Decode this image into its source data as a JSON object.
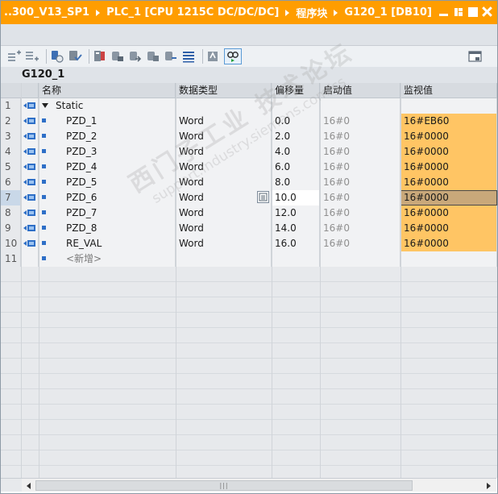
{
  "titlebar": {
    "crumbs": [
      "..300_V13_SP1",
      "PLC_1 [CPU 1215C DC/DC/DC]",
      "程序块",
      "G120_1 [DB10]"
    ]
  },
  "toolbar": {
    "icons": [
      "insert-row-icon",
      "add-row-icon",
      "reset-start-values-icon",
      "load-start-values-icon",
      "snapshot-icon",
      "copy-snapshot-icon",
      "load-snapshot-icon",
      "copy-snapshot-to-start-icon",
      "copy-start-to-snapshot-icon",
      "expand-all-icon",
      "show-settings-icon",
      "monitor-all-icon",
      "layout-icon"
    ]
  },
  "block": {
    "name": "G120_1"
  },
  "table": {
    "headers": [
      "名称",
      "数据类型",
      "偏移量",
      "启动值",
      "监视值"
    ],
    "static_row": {
      "num": "1",
      "name": "Static"
    },
    "rows": [
      {
        "num": "2",
        "name": "PZD_1",
        "type": "Word",
        "offset": "0.0",
        "start": "16#0",
        "monitor": "16#EB60"
      },
      {
        "num": "3",
        "name": "PZD_2",
        "type": "Word",
        "offset": "2.0",
        "start": "16#0",
        "monitor": "16#0000"
      },
      {
        "num": "4",
        "name": "PZD_3",
        "type": "Word",
        "offset": "4.0",
        "start": "16#0",
        "monitor": "16#0000"
      },
      {
        "num": "5",
        "name": "PZD_4",
        "type": "Word",
        "offset": "6.0",
        "start": "16#0",
        "monitor": "16#0000"
      },
      {
        "num": "6",
        "name": "PZD_5",
        "type": "Word",
        "offset": "8.0",
        "start": "16#0",
        "monitor": "16#0000"
      },
      {
        "num": "7",
        "name": "PZD_6",
        "type": "Word",
        "offset": "10.0",
        "start": "16#0",
        "monitor": "16#0000"
      },
      {
        "num": "8",
        "name": "PZD_7",
        "type": "Word",
        "offset": "12.0",
        "start": "16#0",
        "monitor": "16#0000"
      },
      {
        "num": "9",
        "name": "PZD_8",
        "type": "Word",
        "offset": "14.0",
        "start": "16#0",
        "monitor": "16#0000"
      },
      {
        "num": "10",
        "name": "RE_VAL",
        "type": "Word",
        "offset": "16.0",
        "start": "16#0",
        "monitor": "16#0000"
      }
    ],
    "new_row": {
      "num": "11",
      "label": "<新增>"
    }
  },
  "watermark": {
    "line1": "西门子工业 技术论坛",
    "line2": "support.industry.siemens.com/cs"
  },
  "colors": {
    "titlebar": "#ff9d00",
    "monitor_cell": "#ffc564",
    "selected_cell": "#c9a87a"
  }
}
